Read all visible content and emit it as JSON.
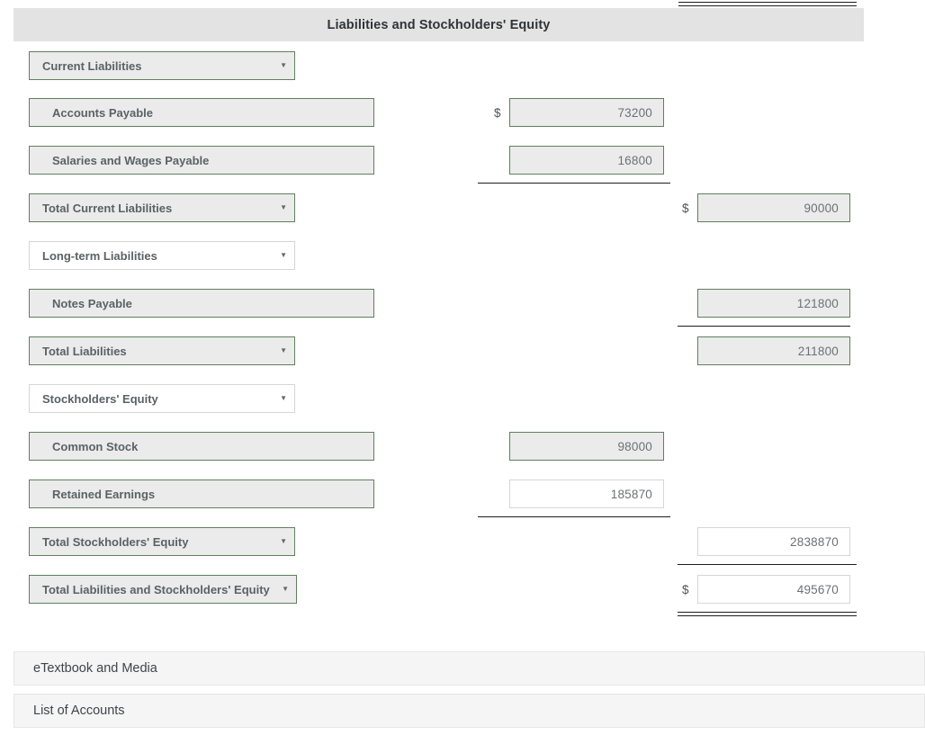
{
  "section": {
    "title": "Liabilities and Stockholders' Equity"
  },
  "currency_symbol": "$",
  "caret_glyph": "▼",
  "rows": [
    {
      "kind": "select",
      "name": "current-liabilities",
      "label": "Current Liabilities",
      "filled": true
    },
    {
      "kind": "entry",
      "name": "accounts-payable",
      "label": "Accounts Payable",
      "value": "73200",
      "column": "mid",
      "currency": true,
      "filled": true
    },
    {
      "kind": "entry",
      "name": "salaries-and-wages-payable",
      "label": "Salaries and Wages Payable",
      "value": "16800",
      "column": "mid",
      "currency": false,
      "filled": true
    },
    {
      "kind": "select",
      "name": "total-current-liabilities",
      "label": "Total Current Liabilities",
      "value": "90000",
      "column": "right",
      "currency": true,
      "filled": true
    },
    {
      "kind": "select",
      "name": "long-term-liabilities",
      "label": "Long-term Liabilities",
      "filled": false
    },
    {
      "kind": "entry",
      "name": "notes-payable",
      "label": "Notes Payable",
      "value": "121800",
      "column": "right",
      "currency": false,
      "filled": true
    },
    {
      "kind": "select",
      "name": "total-liabilities",
      "label": "Total Liabilities",
      "value": "211800",
      "column": "right",
      "currency": false,
      "filled": true
    },
    {
      "kind": "select",
      "name": "stockholders-equity",
      "label": "Stockholders' Equity",
      "filled": false
    },
    {
      "kind": "entry",
      "name": "common-stock",
      "label": "Common Stock",
      "value": "98000",
      "column": "mid",
      "currency": false,
      "filled": true
    },
    {
      "kind": "entry",
      "name": "retained-earnings",
      "label": "Retained Earnings",
      "value": "185870",
      "column": "mid",
      "currency": false,
      "filled": false
    },
    {
      "kind": "select",
      "name": "total-stockholders-equity",
      "label": "Total Stockholders' Equity",
      "value": "2838870",
      "column": "right",
      "currency": false,
      "filled": false
    },
    {
      "kind": "select",
      "name": "total-liabilities-and-stockholders-equity",
      "label": "Total Liabilities and Stockholders' Equity",
      "value": "495670",
      "column": "right",
      "currency": true,
      "filled": false
    }
  ],
  "footer": {
    "etextbook_label": "eTextbook and Media",
    "list_of_accounts_label": "List of Accounts"
  }
}
